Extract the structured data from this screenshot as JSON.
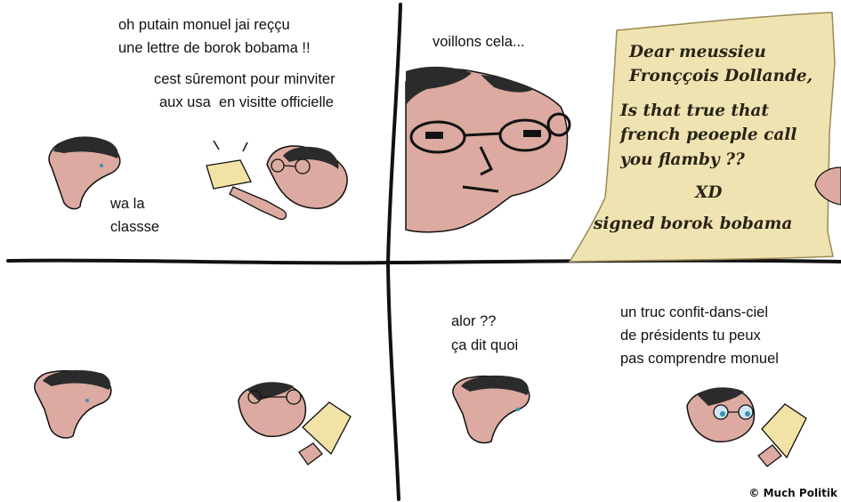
{
  "panel1": {
    "text_line1": "oh putain monuel jai reççu",
    "text_line2": "une lettre de borok bobama !!",
    "text_line3": "cest sûremont pour minviter",
    "text_line4": "aux usa  en visitte officielle",
    "text_line5": "wa la",
    "text_line6": "classse"
  },
  "panel2": {
    "text_line1": "voillons cela...",
    "letter": {
      "line1": "Dear meussieu",
      "line2": "Fronççois Dollande,",
      "line3": "Is that true that",
      "line4": "french peoeple call",
      "line5": "you flamby ??",
      "line6": "XD",
      "line7": "signed borok bobama"
    }
  },
  "panel4": {
    "text_line1": "alor ??",
    "text_line2": "ça dit quoi",
    "text_line3": "un truc confit-dans-ciel",
    "text_line4": "de présidents tu peux",
    "text_line5": "pas comprendre monuel"
  },
  "credit": "© Much Politik",
  "colors": {
    "skin": "#dcaaa0",
    "paper": "#f6e9b2",
    "letter_parchment": "#efe3b2",
    "ink": "#111111",
    "hair": "#2b2b2b",
    "eye": "#3a8fb0"
  }
}
